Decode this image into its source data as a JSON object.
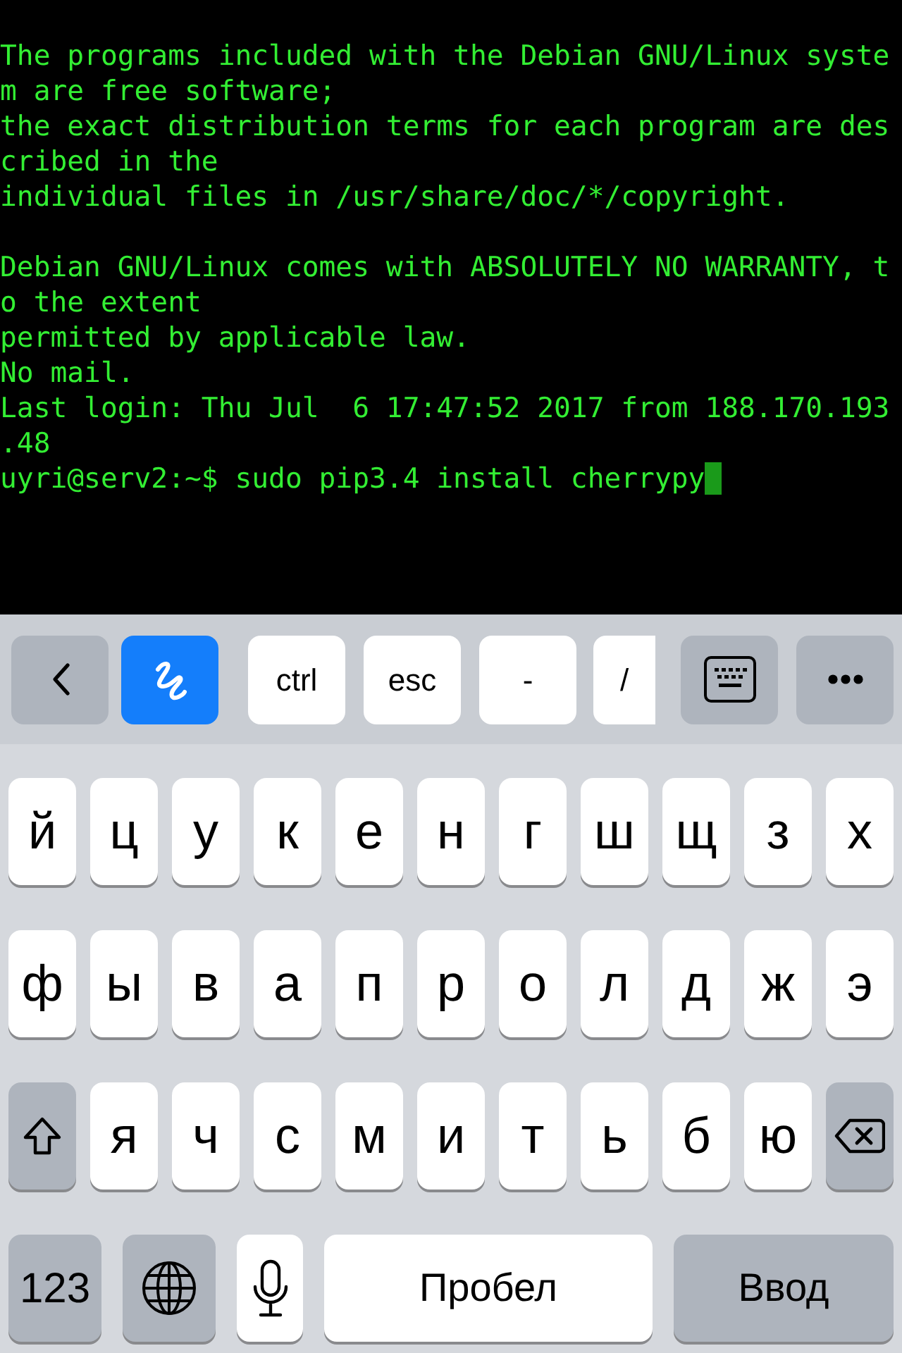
{
  "terminal": {
    "blocks": [
      [
        "The programs included with the Debian GNU/Linux syste",
        "m are free software;",
        "the exact distribution terms for each program are des",
        "cribed in the",
        "individual files in /usr/share/doc/*/copyright."
      ],
      [
        "Debian GNU/Linux comes with ABSOLUTELY NO WARRANTY, t",
        "o the extent",
        "permitted by applicable law.",
        "No mail.",
        "Last login: Thu Jul  6 17:47:52 2017 from 188.170.193",
        ".48"
      ]
    ],
    "prompt": "uyri@serv2:~$ sudo pip3.4 install cherrypy",
    "cursor": true
  },
  "toolbar": [
    {
      "kind": "back",
      "active": false
    },
    {
      "kind": "draw",
      "active": true
    },
    {
      "kind": "text",
      "label": "ctrl",
      "active": false
    },
    {
      "kind": "text",
      "label": "esc",
      "active": false
    },
    {
      "kind": "text",
      "label": "-",
      "active": false
    },
    {
      "kind": "partial",
      "label": "/",
      "active": false
    },
    {
      "kind": "keyboard",
      "active": false
    },
    {
      "kind": "more",
      "active": false
    }
  ],
  "rows": [
    [
      {
        "kind": "letter",
        "label": "й"
      },
      {
        "kind": "letter",
        "label": "ц"
      },
      {
        "kind": "letter",
        "label": "у"
      },
      {
        "kind": "letter",
        "label": "к"
      },
      {
        "kind": "letter",
        "label": "е"
      },
      {
        "kind": "letter",
        "label": "н"
      },
      {
        "kind": "letter",
        "label": "г"
      },
      {
        "kind": "letter",
        "label": "ш"
      },
      {
        "kind": "letter",
        "label": "щ"
      },
      {
        "kind": "letter",
        "label": "з"
      },
      {
        "kind": "letter",
        "label": "х"
      }
    ],
    [
      {
        "kind": "letter",
        "label": "ф"
      },
      {
        "kind": "letter",
        "label": "ы"
      },
      {
        "kind": "letter",
        "label": "в"
      },
      {
        "kind": "letter",
        "label": "а"
      },
      {
        "kind": "letter",
        "label": "п"
      },
      {
        "kind": "letter",
        "label": "р"
      },
      {
        "kind": "letter",
        "label": "о"
      },
      {
        "kind": "letter",
        "label": "л"
      },
      {
        "kind": "letter",
        "label": "д"
      },
      {
        "kind": "letter",
        "label": "ж"
      },
      {
        "kind": "letter",
        "label": "э"
      }
    ],
    [
      {
        "kind": "shift"
      },
      {
        "kind": "letter",
        "label": "я"
      },
      {
        "kind": "letter",
        "label": "ч"
      },
      {
        "kind": "letter",
        "label": "с"
      },
      {
        "kind": "letter",
        "label": "м"
      },
      {
        "kind": "letter",
        "label": "и"
      },
      {
        "kind": "letter",
        "label": "т"
      },
      {
        "kind": "letter",
        "label": "ь"
      },
      {
        "kind": "letter",
        "label": "б"
      },
      {
        "kind": "letter",
        "label": "ю"
      },
      {
        "kind": "backspace"
      }
    ],
    [
      {
        "kind": "mode",
        "label": "123"
      },
      {
        "kind": "globe"
      },
      {
        "kind": "mic"
      },
      {
        "kind": "space",
        "label": "Пробел"
      },
      {
        "kind": "return",
        "label": "Ввод"
      }
    ]
  ]
}
